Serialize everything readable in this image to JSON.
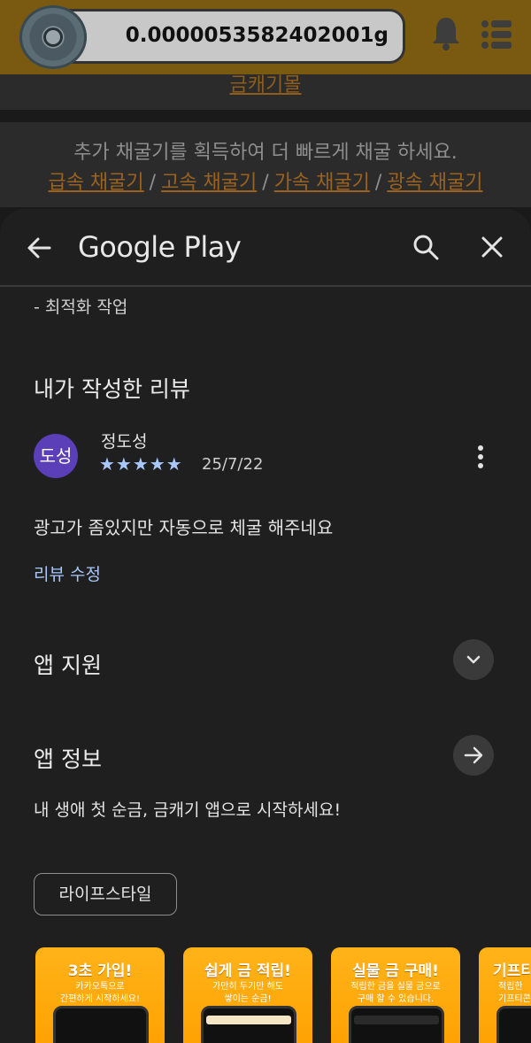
{
  "background_app": {
    "balance": "0.0000053582402001g",
    "top_link": "금캐기몰",
    "promo_text": "추가 채굴기를 획득하여 더 빠르게 채굴 하세요.",
    "miners": [
      "급속 채굴기",
      "고속 채굴기",
      "가속 채굴기",
      "광속 채굴기"
    ],
    "separator": "/"
  },
  "sheet": {
    "title": "Google Play",
    "opt_text": "- 최적화 작업",
    "my_review_title": "내가 작성한 리뷰",
    "review": {
      "avatar_initials": "도성",
      "name": "정도성",
      "stars": "★★★★★",
      "rating": 5,
      "date": "25/7/22",
      "body": "광고가 좀있지만 자동으로 체굴 해주네요",
      "edit_label": "리뷰 수정"
    },
    "app_support": "앱 지원",
    "app_info": "앱 정보",
    "app_desc": "내 생애 첫 순금, 금캐기 앱으로 시작하세요!",
    "category_chip": "라이프스타일",
    "screenshots": [
      {
        "title": "3초 가입!",
        "sub": "카카오톡으로\n간편하게 시작하세요!"
      },
      {
        "title": "쉽게 금 적립!",
        "sub": "가만히 두기만 해도\n쌓이는 순금!"
      },
      {
        "title": "실물 금 구매!",
        "sub": "적립한 금을 실물 금으로\n구매 할 수 있습니다."
      },
      {
        "title": "기프티",
        "sub": "적립한\n기프티콘"
      }
    ]
  },
  "colors": {
    "accent_blue": "#a8c7fa",
    "avatar_purple": "#5b3fb8",
    "gold": "#ffa000"
  }
}
